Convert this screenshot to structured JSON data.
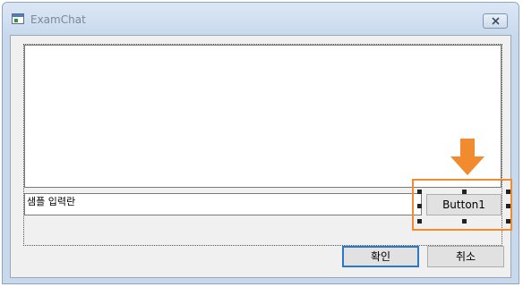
{
  "window": {
    "title": "ExamChat"
  },
  "form": {
    "input_text": "샘플 입력란",
    "button1_label": "Button1",
    "ok_label": "확인",
    "cancel_label": "취소"
  },
  "annotation": {
    "color": "#f28a2e"
  },
  "icons": {
    "app": "window-icon",
    "close": "close-icon",
    "arrow": "arrow-down-icon"
  }
}
